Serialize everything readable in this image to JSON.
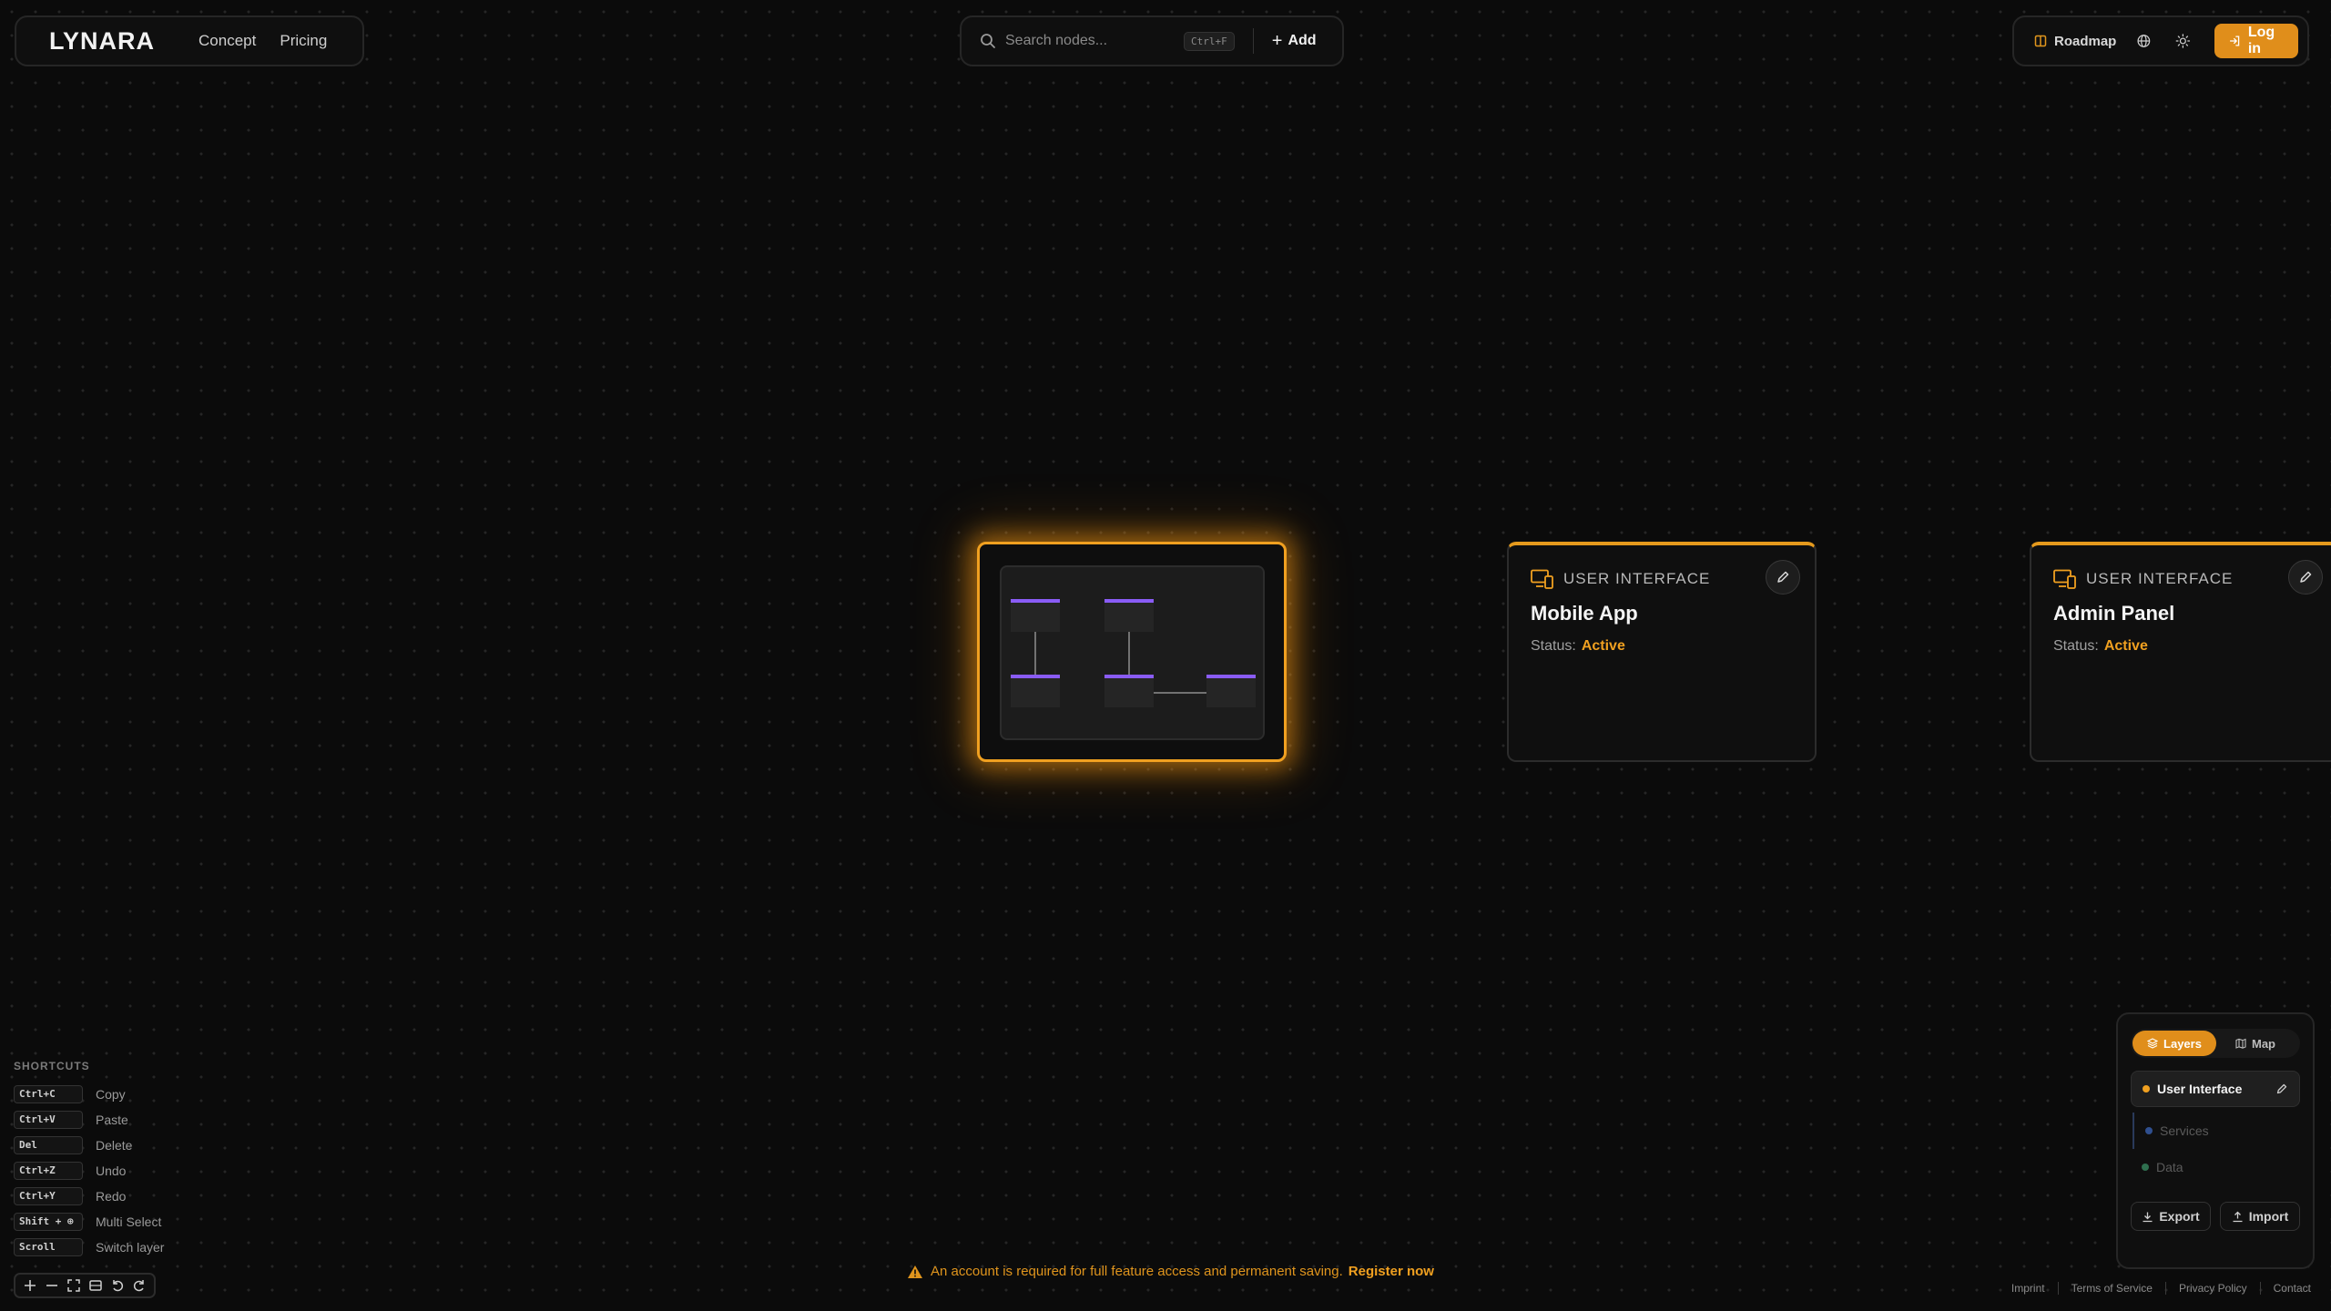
{
  "brand": {
    "name": "LYNARA"
  },
  "nav": {
    "concept": "Concept",
    "pricing": "Pricing"
  },
  "search": {
    "placeholder": "Search nodes...",
    "shortcut": "Ctrl+F",
    "add_label": "Add"
  },
  "toolbar": {
    "roadmap": "Roadmap",
    "login": "Log in",
    "icons": [
      "globe-icon",
      "sun-icon"
    ]
  },
  "nodes": [
    {
      "type": "USER INTERFACE",
      "title": "Mobile App",
      "status_label": "Status:",
      "status_value": "Active"
    },
    {
      "type": "USER INTERFACE",
      "title": "Admin Panel",
      "status_label": "Status:",
      "status_value": "Active"
    }
  ],
  "shortcuts": {
    "title": "SHORTCUTS",
    "items": [
      {
        "key": "Ctrl+C",
        "label": "Copy"
      },
      {
        "key": "Ctrl+V",
        "label": "Paste"
      },
      {
        "key": "Del",
        "label": "Delete"
      },
      {
        "key": "Ctrl+Z",
        "label": "Undo"
      },
      {
        "key": "Ctrl+Y",
        "label": "Redo"
      },
      {
        "key": "Shift + ⊕",
        "label": "Multi Select"
      },
      {
        "key": "Scroll",
        "label": "Switch layer"
      }
    ]
  },
  "banner": {
    "text": "An account is required for full feature access and permanent saving.",
    "link": "Register now"
  },
  "layers_panel": {
    "tabs": {
      "layers": "Layers",
      "map": "Map"
    },
    "layers": [
      {
        "name": "User Interface",
        "color": "#f0a020"
      },
      {
        "name": "Services",
        "color": "#2f4f8f"
      },
      {
        "name": "Data",
        "color": "#2f6f4f"
      }
    ],
    "export": "Export",
    "import": "Import"
  },
  "footer": {
    "imprint": "Imprint",
    "terms": "Terms of Service",
    "privacy": "Privacy Policy",
    "contact": "Contact"
  },
  "colors": {
    "accent": "#f0a020",
    "button": "#e08e1b",
    "diagram_block": "#8a5cf6",
    "background": "#0b0b0b"
  }
}
